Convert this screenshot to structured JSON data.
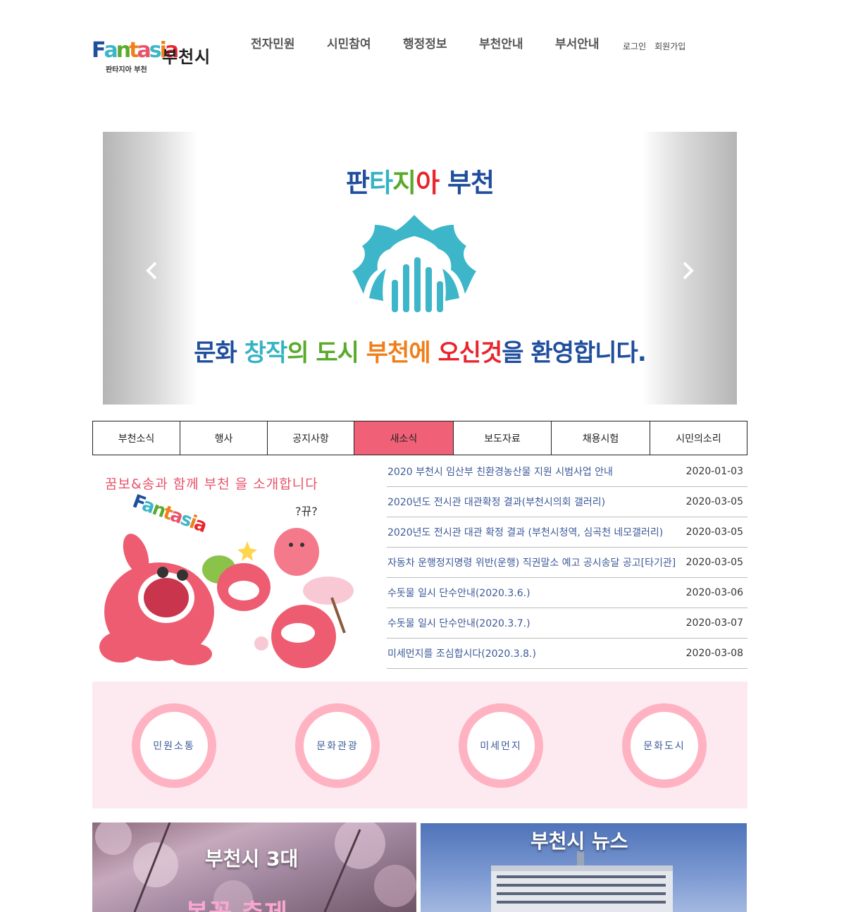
{
  "header": {
    "logo_word": "Fantasia",
    "logo_city": "부천시",
    "logo_sub": "판타지아 부천",
    "nav": [
      "전자민원",
      "시민참여",
      "행정정보",
      "부천안내",
      "부서안내"
    ],
    "login": "로그인",
    "signup": "회원가입"
  },
  "hero": {
    "title_parts": [
      "판",
      "타",
      "지",
      "아",
      " 부천"
    ],
    "slogan_parts": [
      "문화 ",
      "창작",
      "의 ",
      "도시 ",
      "부천에 ",
      "오신것",
      "을 환영합니다."
    ],
    "prev_icon": "chevron-left-icon",
    "next_icon": "chevron-right-icon",
    "colors": {
      "blue": "#1f4e9c",
      "teal": "#35b3c4",
      "green": "#5aaa2c",
      "orange": "#f07f1a",
      "red": "#e8252c",
      "emblem": "#3db6c9"
    }
  },
  "tabs": [
    "부천소식",
    "행사",
    "공지사항",
    "새소식",
    "보도자료",
    "채용시험",
    "시민의소리"
  ],
  "active_tab": "새소식",
  "promo": {
    "heading": "꿈보&송과 함께 부천 을 소개합니다",
    "logo_word": "Fantasia",
    "bubble": "?뀨?"
  },
  "news": [
    {
      "title": "2020 부천시 임산부 친환경농산물 지원 시범사업 안내",
      "date": "2020-01-03"
    },
    {
      "title": "2020년도 전시관 대관확정 결과(부천시의회 갤러리)",
      "date": "2020-03-05"
    },
    {
      "title": "2020년도 전시관 대관 확정 결과 (부천시청역, 심곡천 네모갤러리)",
      "date": "2020-03-05"
    },
    {
      "title": "자동차 운행정지명령 위반(운행) 직권말소 예고 공시송달 공고[타기관]",
      "date": "2020-03-05"
    },
    {
      "title": "수돗물 일시 단수안내(2020.3.6.)",
      "date": "2020-03-06"
    },
    {
      "title": "수돗물 일시 단수안내(2020.3.7.)",
      "date": "2020-03-07"
    },
    {
      "title": "미세먼지를 조심합시다(2020.3.8.)",
      "date": "2020-03-08"
    }
  ],
  "quick_menu": [
    "민원소통",
    "문화관광",
    "미세먼지",
    "문화도시"
  ],
  "banners": {
    "left_title": "부천시 3대",
    "left_sub": "봄꽃 축제",
    "right_title": "부천시 뉴스"
  }
}
